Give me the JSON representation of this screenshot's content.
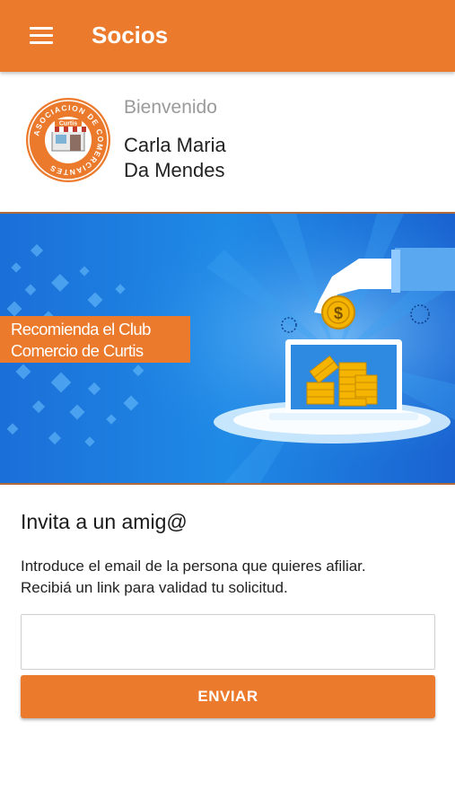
{
  "appbar": {
    "title": "Socios",
    "menu_icon": "hamburger-menu-icon",
    "color": "#ec7a2c"
  },
  "profile": {
    "logo_ring_text": "ASOCIACION DE COMERCIANTES",
    "logo_center_text": "Curtis",
    "welcome": "Bienvenido",
    "name_line1": "Carla Maria",
    "name_line2": "Da Mendes"
  },
  "banner": {
    "caption_line1": "Recomienda el Club",
    "caption_line2": "Comercio de Curtis",
    "coin_symbol": "$"
  },
  "invite": {
    "title": "Invita a un amig@",
    "desc_line1": "Introduce el email de la persona que quieres afiliar.",
    "desc_line2": "Recibiá un link para validad tu solicitud.",
    "email_value": "",
    "email_placeholder": "",
    "send_label": "ENVIAR"
  }
}
